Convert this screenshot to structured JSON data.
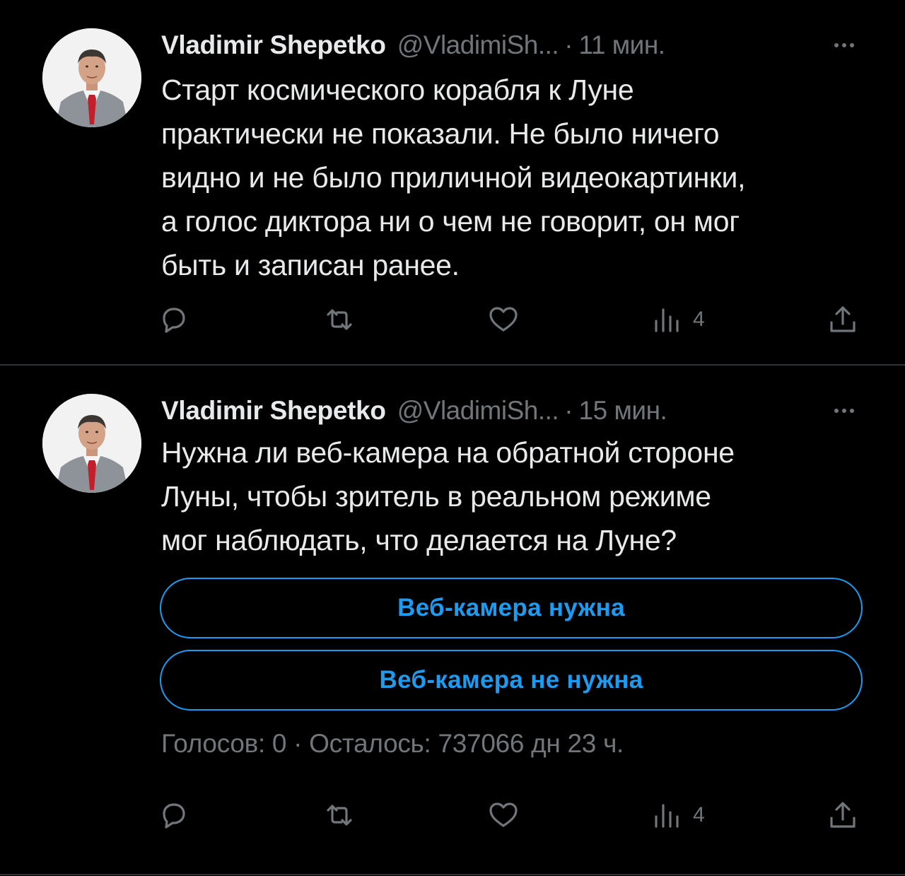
{
  "colors": {
    "background": "#000000",
    "text_primary": "#e7e9ea",
    "text_secondary": "#71767b",
    "accent": "#1d9bf0",
    "divider": "#2f3336"
  },
  "tweets": [
    {
      "display_name": "Vladimir Shepetko",
      "handle": "@VladimiSh...",
      "separator": "·",
      "time": "11 мин.",
      "avatar_icon": "profile-photo-man-suit-red-tie",
      "lines": [
        "Старт космического корабля к Луне",
        "практически не показали. Не было ничего",
        "видно и не было приличной видеокартинки,",
        "а голос диктора ни о чем не говорит, он мог",
        "быть и записан ранее."
      ],
      "actions": {
        "reply_icon": "reply-icon",
        "retweet_icon": "retweet-icon",
        "like_icon": "heart-icon",
        "views_icon": "views-icon",
        "views_count": "4",
        "share_icon": "share-icon"
      }
    },
    {
      "display_name": "Vladimir Shepetko",
      "handle": "@VladimiSh...",
      "separator": "·",
      "time": "15 мин.",
      "avatar_icon": "profile-photo-man-suit-red-tie",
      "lines": [
        "Нужна ли веб-камера на обратной стороне",
        "Луны, чтобы зритель в реальном режиме",
        "мог наблюдать, что делается на Луне?"
      ],
      "poll": {
        "options": [
          "Веб-камера нужна",
          "Веб-камера не нужна"
        ],
        "meta": "Голосов: 0 · Осталось: 737066 дн 23 ч."
      },
      "actions": {
        "reply_icon": "reply-icon",
        "retweet_icon": "retweet-icon",
        "like_icon": "heart-icon",
        "views_icon": "views-icon",
        "views_count": "4",
        "share_icon": "share-icon"
      }
    }
  ]
}
